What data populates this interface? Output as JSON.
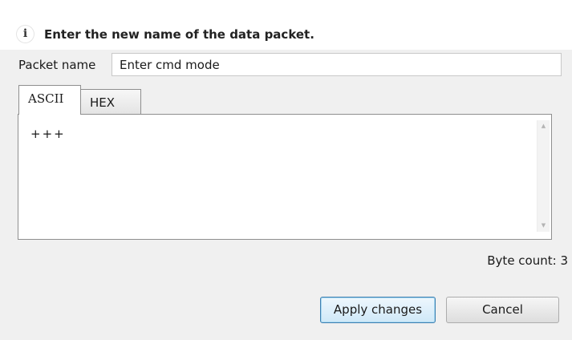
{
  "header": {
    "info_icon": "info-icon",
    "info_icon_glyph": "i",
    "message": "Enter the new name of the data packet."
  },
  "packet": {
    "label": "Packet name",
    "value": "Enter cmd mode"
  },
  "tabs": [
    {
      "label": "ASCII",
      "selected": true
    },
    {
      "label": "HEX",
      "selected": false
    }
  ],
  "editor": {
    "content": "+++",
    "scroll_up_icon": "scroll-up-arrow-icon",
    "scroll_down_icon": "scroll-down-arrow-icon"
  },
  "byte_count": "Byte count: 3",
  "buttons": {
    "apply_label": "Apply changes",
    "cancel_label": "Cancel"
  },
  "colors": {
    "header_bg": "#ffffff",
    "dialog_bg": "#f0f0f0",
    "default_button_border": "#3c7fb1"
  }
}
